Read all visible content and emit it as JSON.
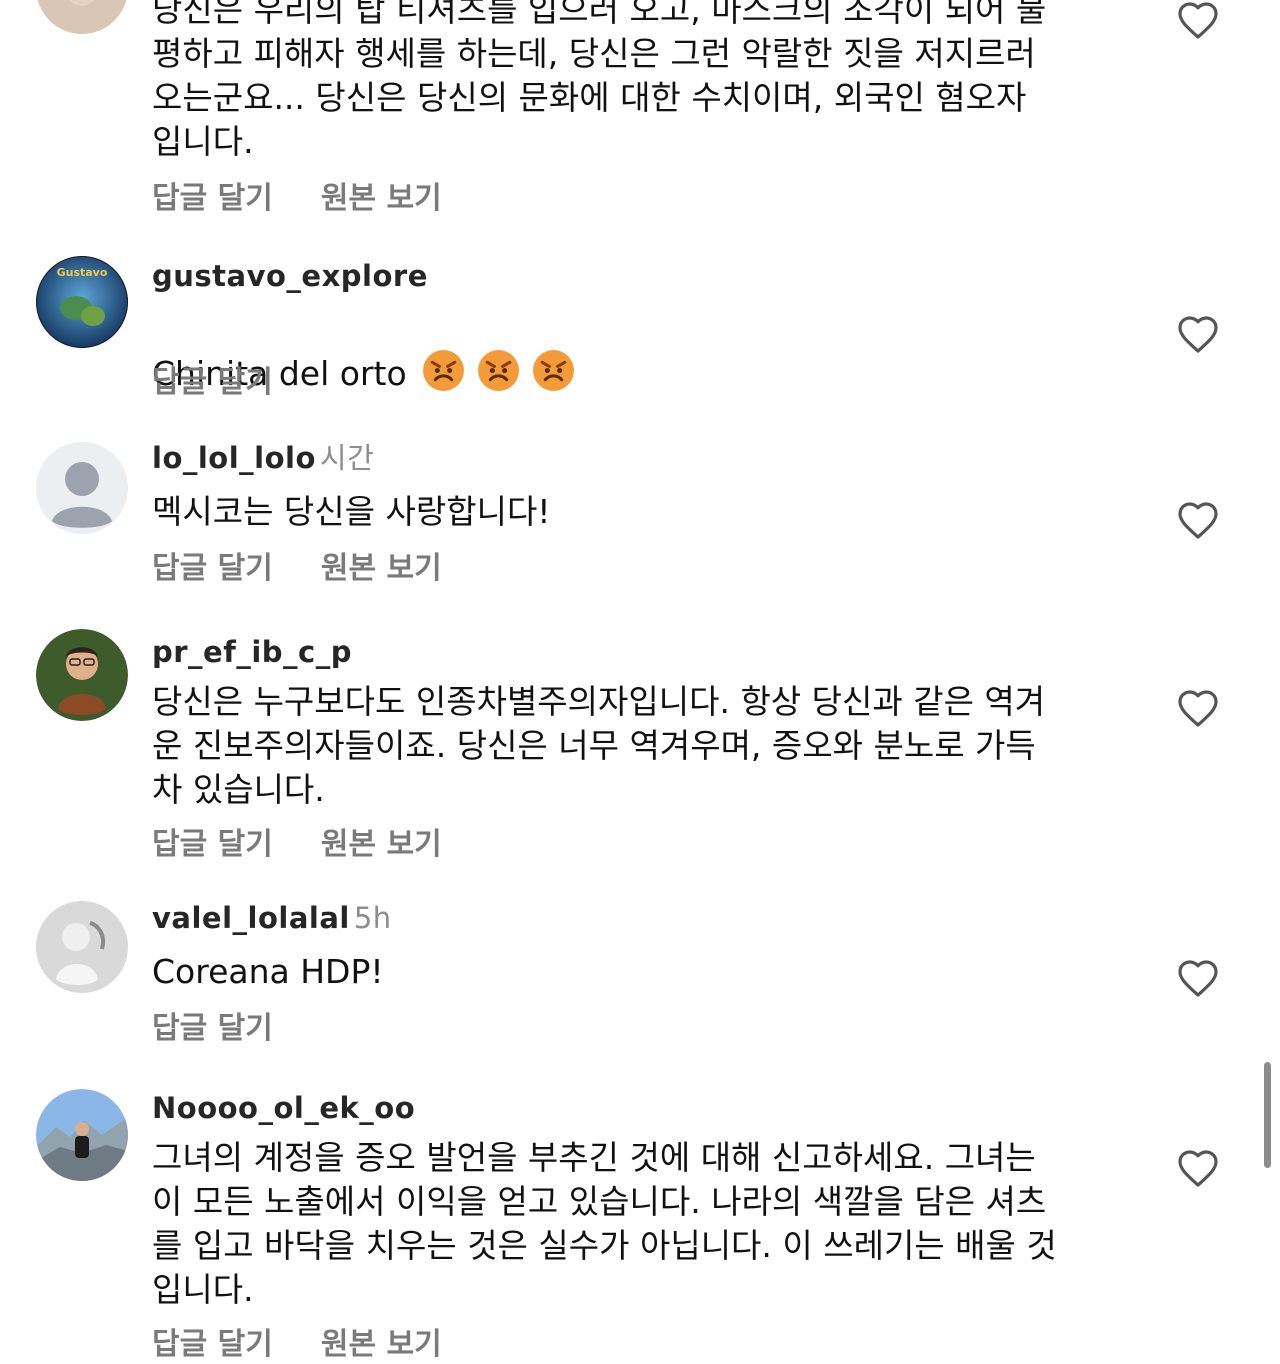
{
  "comments": [
    {
      "username": "",
      "meta": "",
      "text": "당신은 우리의 탑 티셔츠를 입으러 오고, 마스크의 조각이 되어 불\n평하고 피해자 행세를 하는데, 당신은 그런 악랄한 짓을 저지르러\n오는군요... 당신은 당신의 문화에 대한 수치이며, 외국인 혐오자\n입니다.",
      "reply_label": "답글 달기",
      "translate_label": "원본 보기",
      "avatar": "woman-avatar"
    },
    {
      "username": "gustavo_explore",
      "meta": "",
      "text": "Chinita del orto",
      "emoji": [
        "angry-face-icon",
        "angry-face-icon",
        "angry-face-icon"
      ],
      "reply_label": "답글 달기",
      "avatar_badge": "Gustavo",
      "avatar": "globe-avatar"
    },
    {
      "username": "lo_lol_lolo",
      "meta": "시간",
      "text": "멕시코는 당신을 사랑합니다!",
      "reply_label": "답글 달기",
      "translate_label": "원본 보기",
      "avatar": "default-avatar"
    },
    {
      "username": "pr_ef_ib_c_p",
      "meta": "",
      "text": "당신은 누구보다도 인종차별주의자입니다. 항상 당신과 같은 역겨\n운 진보주의자들이죠. 당신은 너무 역겨우며, 증오와 분노로 가득\n차 있습니다.",
      "reply_label": "답글 달기",
      "translate_label": "원본 보기",
      "avatar": "man-avatar"
    },
    {
      "username": "valel_lolalal",
      "meta": "5h",
      "text": "Coreana HDP!",
      "reply_label": "답글 달기",
      "avatar": "baby-avatar"
    },
    {
      "username": "Noooo_ol_ek_oo",
      "meta": "",
      "text": "그녀의 계정을 증오 발언을 부추긴 것에 대해 신고하세요. 그녀는\n이 모든 노출에서 이익을 얻고 있습니다. 나라의 색깔을 담은 셔츠\n를 입고 바닥을 치우는 것은 실수가 아닙니다. 이 쓰레기는 배울 것\n입니다.",
      "reply_label": "답글 달기",
      "translate_label": "원본 보기",
      "avatar": "mountain-avatar"
    }
  ],
  "icons": {
    "heart": "heart-outline-icon",
    "emoji": "angry-face-icon"
  },
  "colors": {
    "text": "#111111",
    "username": "#262626",
    "secondary": "#7a7a7a",
    "heart": "#555555",
    "scrollbar": "#8c8c8c"
  }
}
